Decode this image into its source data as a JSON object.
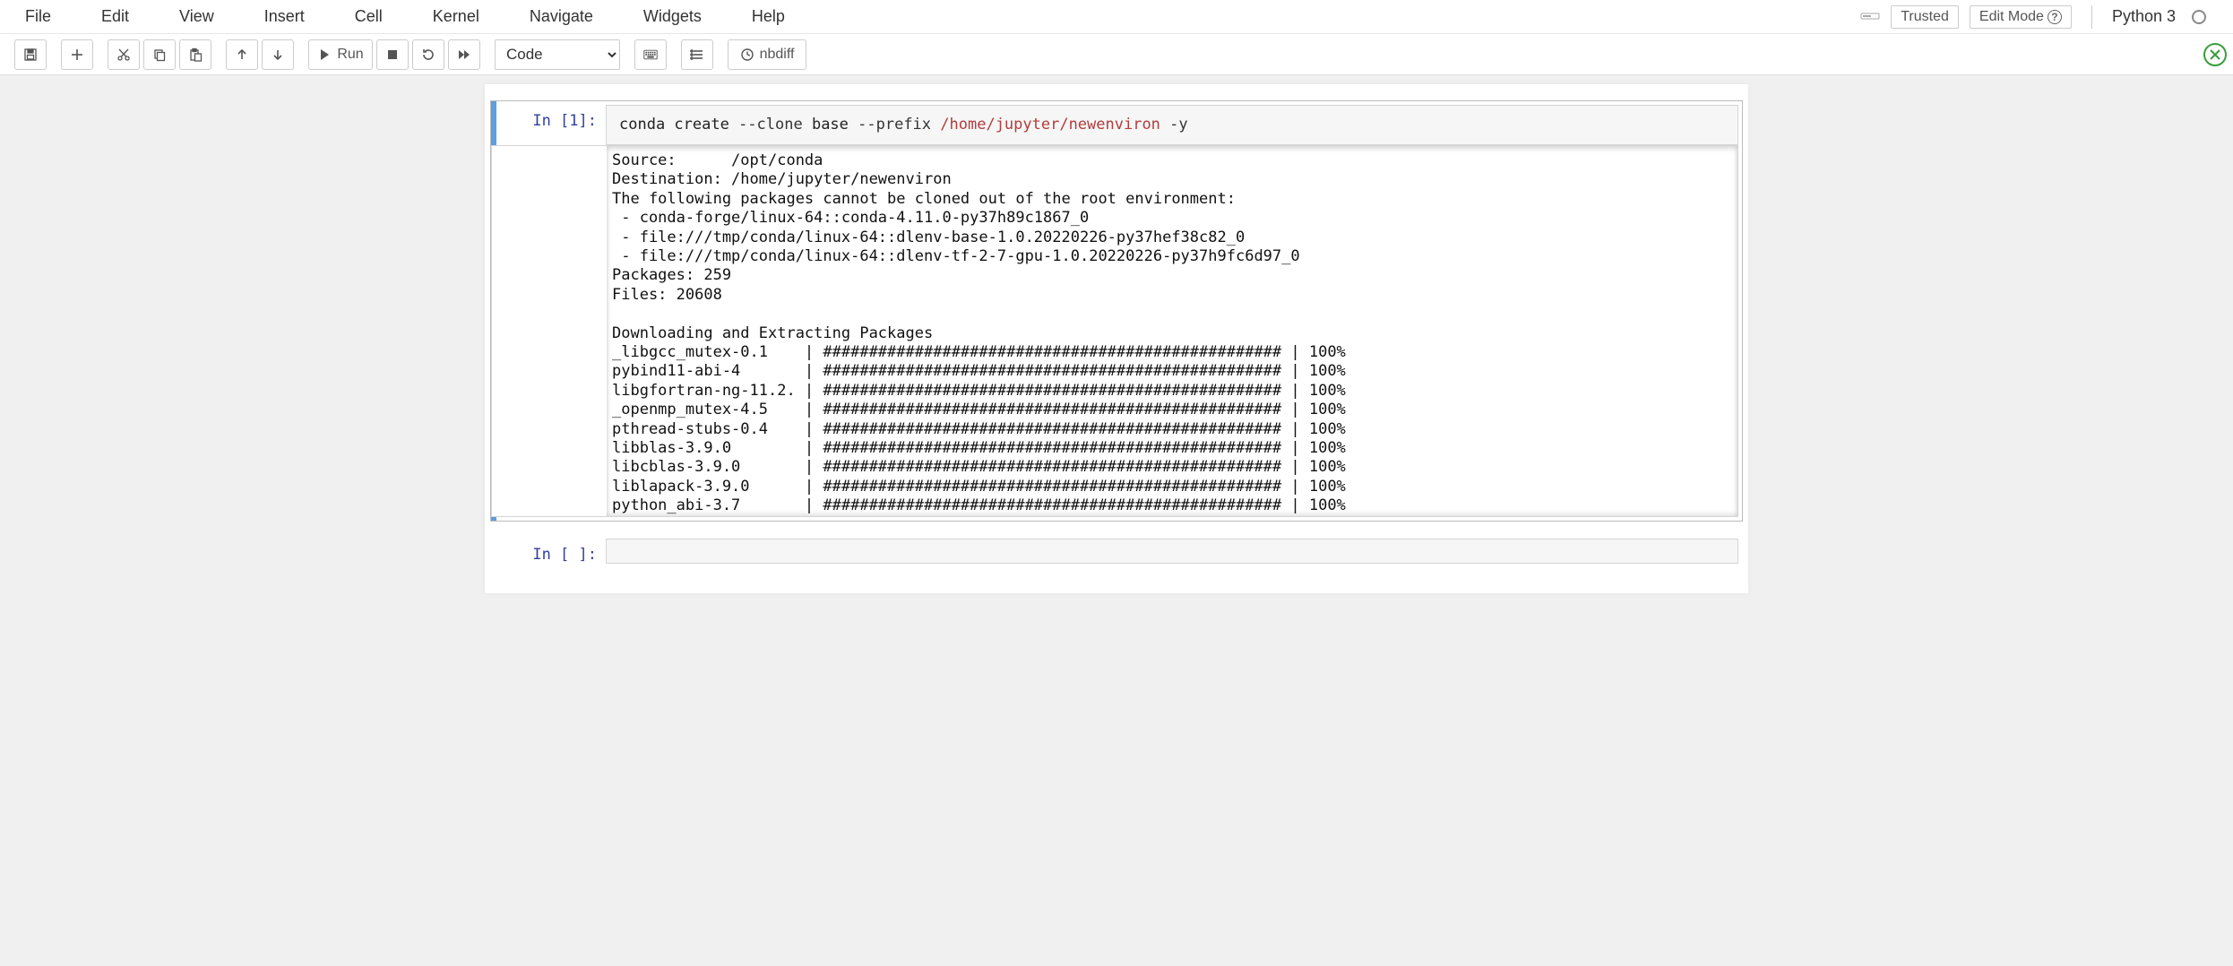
{
  "menubar": {
    "items": [
      "File",
      "Edit",
      "View",
      "Insert",
      "Cell",
      "Kernel",
      "Navigate",
      "Widgets",
      "Help"
    ],
    "trusted": "Trusted",
    "edit_mode": "Edit Mode",
    "kernel_name": "Python 3"
  },
  "toolbar": {
    "run_label": "Run",
    "nbdiff_label": "nbdiff",
    "celltype_selected": "Code"
  },
  "cells": [
    {
      "prompt": "In [1]:",
      "code_plain": "conda create ",
      "code_opt1": "--clone",
      "code_mid1": " base ",
      "code_opt2": "--prefix",
      "code_mid2": " ",
      "code_path": "/home/jupyter/newenviron",
      "code_end": " ",
      "code_opt3": "-y",
      "output": "Source:      /opt/conda\nDestination: /home/jupyter/newenviron\nThe following packages cannot be cloned out of the root environment:\n - conda-forge/linux-64::conda-4.11.0-py37h89c1867_0\n - file:///tmp/conda/linux-64::dlenv-base-1.0.20220226-py37hef38c82_0\n - file:///tmp/conda/linux-64::dlenv-tf-2-7-gpu-1.0.20220226-py37h9fc6d97_0\nPackages: 259\nFiles: 20608\n\nDownloading and Extracting Packages\n_libgcc_mutex-0.1    | ################################################## | 100%\npybind11-abi-4       | ################################################## | 100%\nlibgfortran-ng-11.2. | ################################################## | 100%\n_openmp_mutex-4.5    | ################################################## | 100%\npthread-stubs-0.4    | ################################################## | 100%\nlibblas-3.9.0        | ################################################## | 100%\nlibcblas-3.9.0       | ################################################## | 100%\nliblapack-3.9.0      | ################################################## | 100%\npython_abi-3.7       | ################################################## | 100%"
    },
    {
      "prompt": "In [ ]:",
      "code": ""
    }
  ]
}
